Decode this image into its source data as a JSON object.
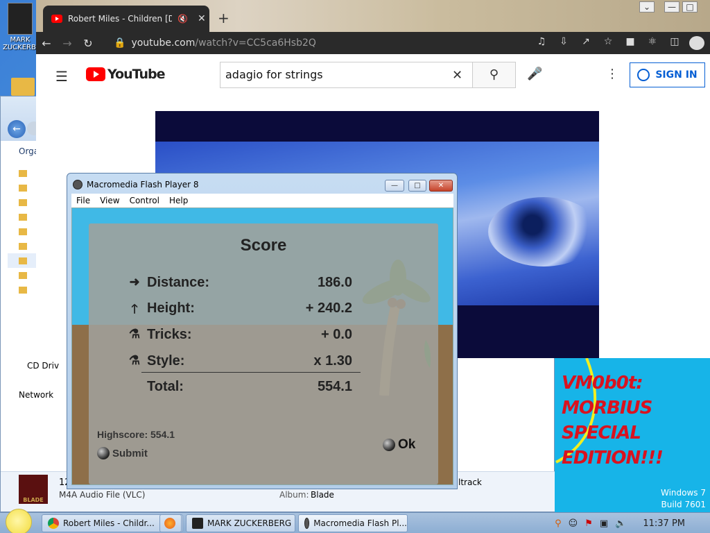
{
  "desktop": {
    "icon_label_line1": "MARK",
    "icon_label_line2": "ZUCKERBERG"
  },
  "explorer": {
    "organize_label": "Orga",
    "cd_drive_label": "CD Driv",
    "network_label": "Network",
    "details": {
      "file_number": "12",
      "file_type": "M4A Audio File (VLC)",
      "album_label": "Album:",
      "album_value": "Blade",
      "track_partial": "ltrack",
      "thumb_text": "BLADE"
    }
  },
  "chrome": {
    "tab_title": "Robert Miles - Children [Dre",
    "url_domain": "youtube.com",
    "url_path": "/watch?v=CC5ca6Hsb2Q"
  },
  "youtube": {
    "logo_text": "YouTube",
    "search_value": "adagio for strings",
    "signin_label": "SIGN IN"
  },
  "flash": {
    "window_title": "Macromedia Flash Player 8",
    "menu": [
      "File",
      "View",
      "Control",
      "Help"
    ],
    "score": {
      "title": "Score",
      "rows": [
        {
          "icon": "arrow-right-icon",
          "label": "Distance:",
          "value": "186.0"
        },
        {
          "icon": "arrow-up-icon",
          "label": "Height:",
          "value": "+ 240.2"
        },
        {
          "icon": "tricks-icon",
          "label": "Tricks:",
          "value": "+ 0.0"
        },
        {
          "icon": "style-icon",
          "label": "Style:",
          "value": "x 1.30"
        }
      ],
      "total_label": "Total:",
      "total_value": "554.1",
      "highscore": "Highscore: 554.1",
      "submit_label": "Submit",
      "ok_label": "Ok"
    }
  },
  "panel": {
    "vm_line1": "VM0b0t:",
    "vm_line2": "MORBIUS",
    "vm_line3": "SPECIAL",
    "vm_line4": "EDITION!!!",
    "windows_line1": "Windows 7",
    "windows_line2": "Build 7601",
    "text_color": "#d9121f",
    "bg_color": "#17b4e8"
  },
  "taskbar": {
    "buttons": [
      {
        "label": "Robert Miles - Childr..."
      },
      {
        "label": ""
      },
      {
        "label": "MARK ZUCKERBERG"
      },
      {
        "label": "Macromedia Flash Pl..."
      }
    ],
    "clock": "11:37 PM"
  }
}
